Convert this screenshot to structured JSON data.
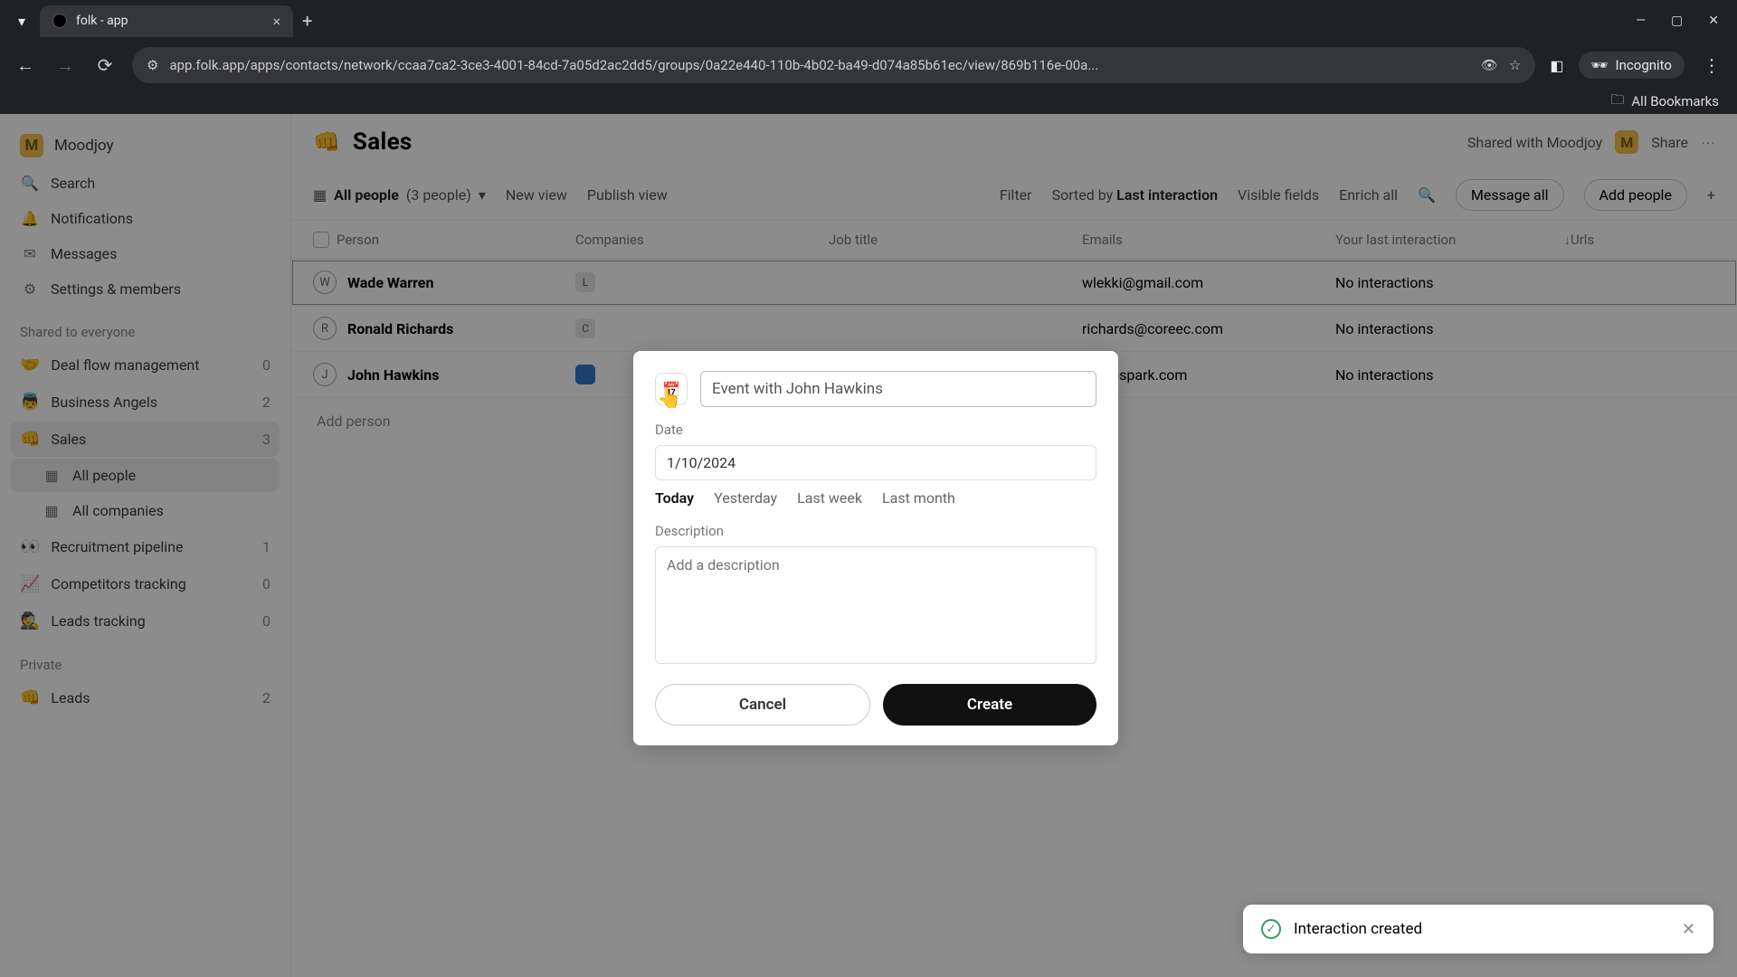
{
  "browser": {
    "tab_title": "folk - app",
    "url": "app.folk.app/apps/contacts/network/ccaa7ca2-3ce3-4001-84cd-7a05d2ac2dd5/groups/0a22e440-110b-4b02-ba49-d074a85b61ec/view/869b116e-00a...",
    "incognito": "Incognito",
    "all_bookmarks": "All Bookmarks"
  },
  "sidebar": {
    "workspace": "Moodjoy",
    "search": "Search",
    "notifications": "Notifications",
    "messages": "Messages",
    "settings": "Settings & members",
    "shared_header": "Shared to everyone",
    "items": [
      {
        "emoji": "🤝",
        "label": "Deal flow management",
        "count": "0"
      },
      {
        "emoji": "👼",
        "label": "Business Angels",
        "count": "2"
      },
      {
        "emoji": "👊",
        "label": "Sales",
        "count": "3"
      },
      {
        "emoji": "👀",
        "label": "Recruitment pipeline",
        "count": "1"
      },
      {
        "emoji": "📈",
        "label": "Competitors tracking",
        "count": "0"
      },
      {
        "emoji": "🕵️",
        "label": "Leads tracking",
        "count": "0"
      }
    ],
    "sub_all_people": "All people",
    "sub_all_companies": "All companies",
    "private_header": "Private",
    "leads": {
      "emoji": "👊",
      "label": "Leads",
      "count": "2"
    }
  },
  "page": {
    "emoji": "👊",
    "title": "Sales",
    "shared_with": "Shared with Moodjoy",
    "share": "Share"
  },
  "toolbar": {
    "view_name": "All people",
    "view_count": "(3 people)",
    "new_view": "New view",
    "publish": "Publish view",
    "filter": "Filter",
    "sorted_by": "Sorted by",
    "sort_field": "Last interaction",
    "visible": "Visible fields",
    "enrich": "Enrich all",
    "message_all": "Message all",
    "add_people": "Add people"
  },
  "table": {
    "cols": {
      "person": "Person",
      "companies": "Companies",
      "job": "Job title",
      "emails": "Emails",
      "interaction": "Your last interaction",
      "urls": "Urls"
    },
    "rows": [
      {
        "initial": "W",
        "name": "Wade Warren",
        "chip": "L",
        "email": "wlekki@gmail.com",
        "interaction": "No interactions"
      },
      {
        "initial": "R",
        "name": "Ronald Richards",
        "chip": "C",
        "email": "richards@coreec.com",
        "interaction": "No interactions"
      },
      {
        "initial": "J",
        "name": "John Hawkins",
        "chip": "",
        "email": "ohn@spark.com",
        "interaction": "No interactions"
      }
    ],
    "add_person": "Add person"
  },
  "modal": {
    "title_value": "Event with John Hawkins",
    "date_label": "Date",
    "date_value": "1/10/2024",
    "quick": {
      "today": "Today",
      "yesterday": "Yesterday",
      "last_week": "Last week",
      "last_month": "Last month"
    },
    "desc_label": "Description",
    "desc_placeholder": "Add a description",
    "cancel": "Cancel",
    "create": "Create"
  },
  "toast": {
    "msg": "Interaction created"
  }
}
